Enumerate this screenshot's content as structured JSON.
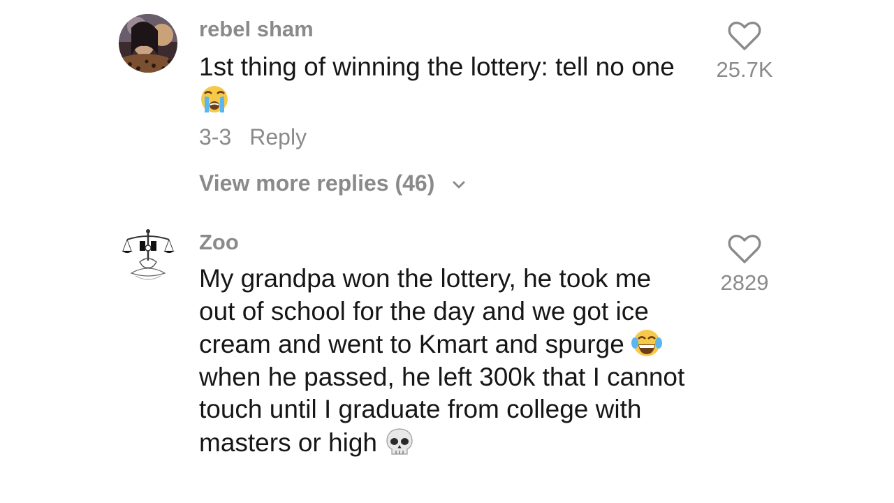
{
  "comments": [
    {
      "username": "rebel sham",
      "text_parts": [
        "1st thing of winning the lottery: tell no one"
      ],
      "emojis": [
        "loudly-crying-face-icon"
      ],
      "date": "3-3",
      "reply_label": "Reply",
      "view_more_label": "View more replies (46)",
      "likes": "25.7K"
    },
    {
      "username": "Zoo",
      "text_parts": [
        "My grandpa won the lottery, he took me out of school for the day and we got ice cream and went to Kmart and spurge",
        "when he passed, he left 300k that I cannot touch until I graduate from college with masters or high"
      ],
      "emojis": [
        "tears-of-joy-face-icon",
        "skull-icon"
      ],
      "likes": "2829"
    }
  ],
  "colors": {
    "username": "#8a8a8a",
    "body_text": "#161616",
    "meta": "#8a8a8a",
    "background": "#ffffff"
  }
}
